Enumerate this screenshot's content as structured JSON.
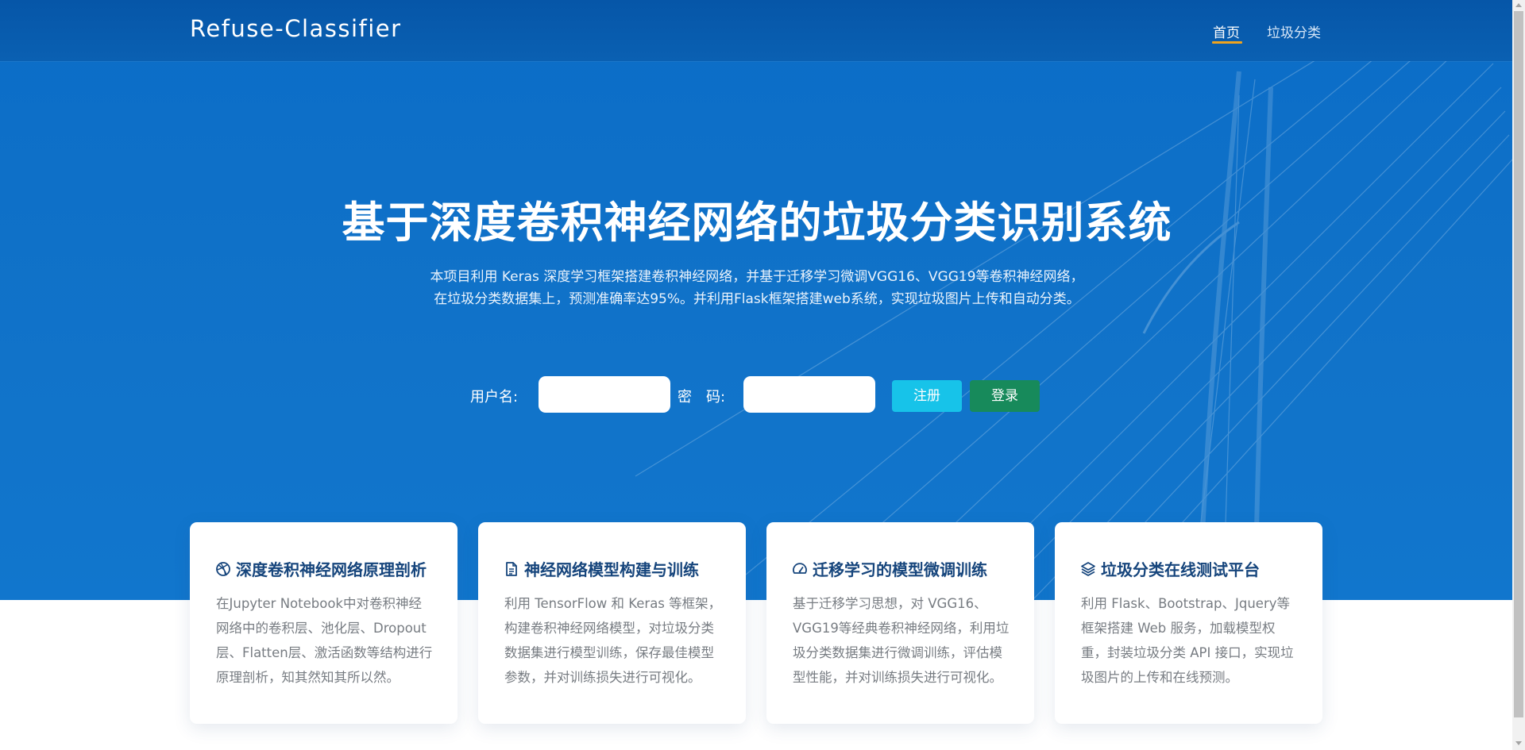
{
  "brand": "Refuse-Classifier",
  "nav": {
    "items": [
      {
        "label": "首页",
        "active": true
      },
      {
        "label": "垃圾分类",
        "active": false
      }
    ],
    "active_underline_color": "#f0a41d"
  },
  "hero": {
    "title": "基于深度卷积神经网络的垃圾分类识别系统",
    "description_lines": [
      "本项目利用 Keras 深度学习框架搭建卷积神经网络，并基于迁移学习微调VGG16、VGG19等卷积神经网络，",
      "在垃圾分类数据集上，预测准确率达95%。并利用Flask框架搭建web系统，实现垃圾图片上传和自动分类。"
    ],
    "background_color": "#0b6dc7"
  },
  "login": {
    "username_label": "用户名:",
    "username_value": "",
    "password_label": "密　码:",
    "password_value": "",
    "register_button": "注册",
    "login_button": "登录",
    "register_color": "#17c3e9",
    "login_color": "#178a5b"
  },
  "cards": [
    {
      "icon": "dribbble-icon",
      "title": "深度卷积神经网络原理剖析",
      "body": "在Jupyter Notebook中对卷积神经网络中的卷积层、池化层、Dropout层、Flatten层、激活函数等结构进行原理剖析，知其然知其所以然。"
    },
    {
      "icon": "document-icon",
      "title": "神经网络模型构建与训练",
      "body": "利用 TensorFlow 和 Keras 等框架，构建卷积神经网络模型，对垃圾分类数据集进行模型训练，保存最佳模型参数，并对训练损失进行可视化。"
    },
    {
      "icon": "speedometer-icon",
      "title": "迁移学习的模型微调训练",
      "body": "基于迁移学习思想，对 VGG16、VGG19等经典卷积神经网络，利用垃圾分类数据集进行微调训练，评估模型性能，并对训练损失进行可视化。"
    },
    {
      "icon": "layers-icon",
      "title": "垃圾分类在线测试平台",
      "body": "利用 Flask、Bootstrap、Jquery等框架搭建 Web 服务，加载模型权重，封装垃圾分类 API 接口，实现垃圾图片的上传和在线预测。"
    }
  ],
  "colors": {
    "card_title": "#16457c",
    "card_body": "#777c82"
  }
}
